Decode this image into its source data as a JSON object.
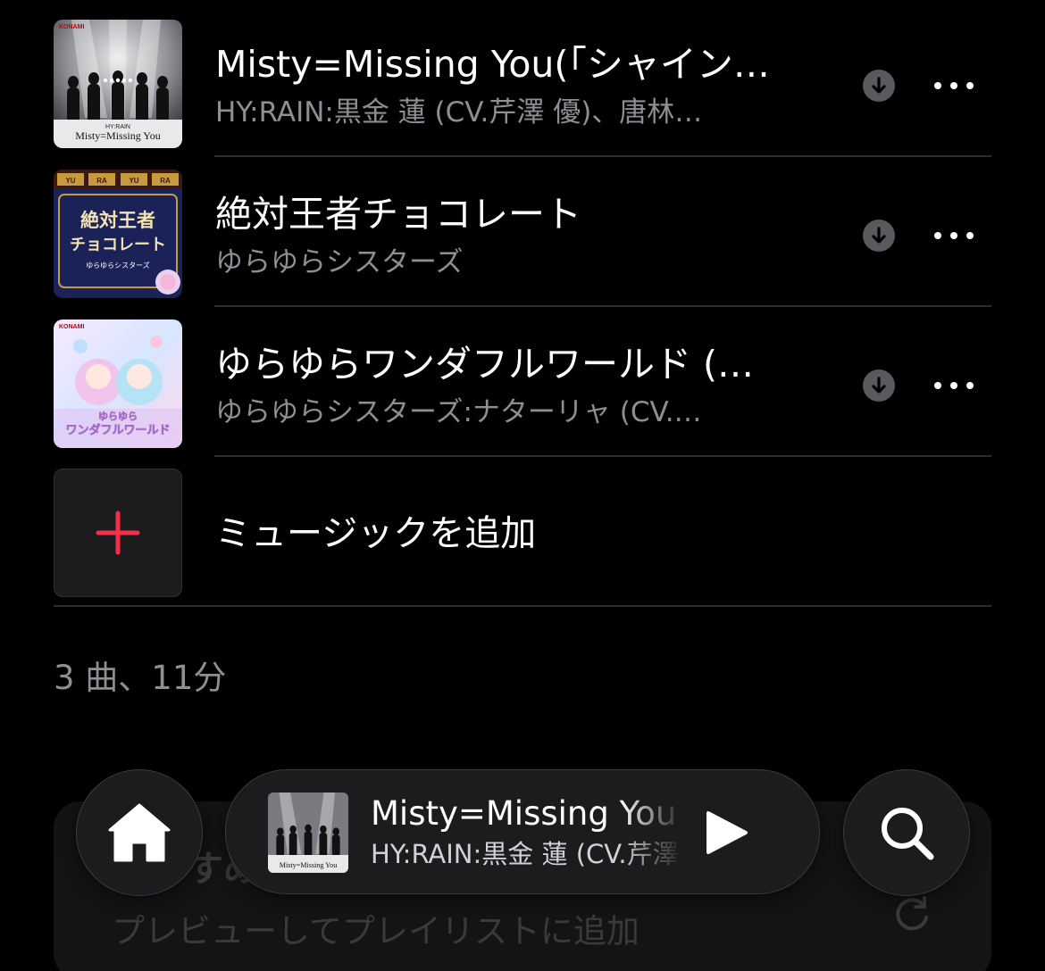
{
  "tracks": [
    {
      "title": "Misty=Missing You(「シャイン…",
      "artist": "HY:RAIN:黒金 蓮 (CV.芹澤 優)、唐林…",
      "art_label": "KONAMI",
      "art_caption": "Misty=Missing You",
      "art_group": "HY:RAIN",
      "download_icon": "download-icon",
      "more_icon": "ellipsis-icon"
    },
    {
      "title": "絶対王者チョコレート",
      "artist": "ゆらゆらシスターズ",
      "art_banner": [
        "YU",
        "RA",
        "YU",
        "RA"
      ],
      "art_line1": "絶対王者",
      "art_line2": "チョコレート",
      "art_sub": "ゆらゆらシスターズ",
      "download_icon": "download-icon",
      "more_icon": "ellipsis-icon"
    },
    {
      "title": "ゆらゆらワンダフルワールド (…",
      "artist": "ゆらゆらシスターズ:ナターリャ (CV.…",
      "art_label": "KONAMI",
      "art_caption": "ワンダフルワールド",
      "art_top": "ゆらゆら",
      "download_icon": "download-icon",
      "more_icon": "ellipsis-icon"
    }
  ],
  "add_music": {
    "label": "ミュージックを追加",
    "icon": "plus-icon",
    "accent": "#fa2d48"
  },
  "summary": "3 曲、11分",
  "background_card": {
    "title": "おすすめの曲",
    "subtitle": "プレビューしてプレイリストに追加",
    "icon": "refresh-icon"
  },
  "tab_bar": {
    "home_icon": "home-icon",
    "search_icon": "search-icon"
  },
  "now_playing": {
    "title": "Misty=Missing You",
    "artist": "HY:RAIN:黒金 蓮 (CV.芹澤 優)",
    "art_caption": "Misty=Missing You",
    "play_icon": "play-icon"
  }
}
